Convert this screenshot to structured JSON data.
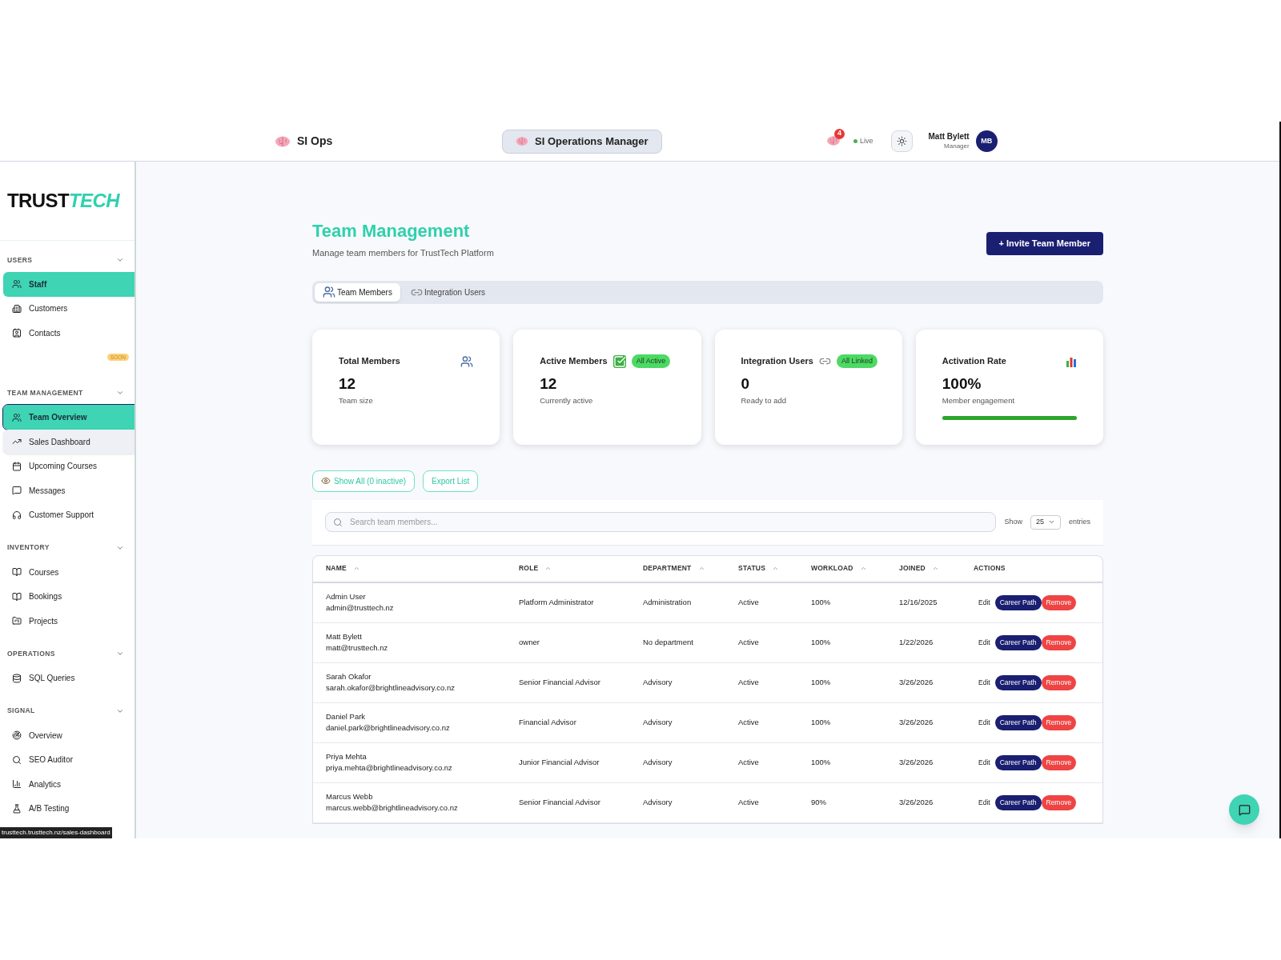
{
  "header": {
    "app_name": "SI Ops",
    "center_title": "SI Operations Manager",
    "notification_count": "4",
    "live_label": "Live",
    "user": {
      "name": "Matt Bylett",
      "role": "Manager",
      "initials": "MB"
    }
  },
  "sidebar": {
    "logo": {
      "first": "TRUST",
      "second": "TECH"
    },
    "sections": [
      {
        "title": "USERS",
        "expanded": true,
        "items": [
          {
            "label": "Staff",
            "selected": true,
            "hovered": false,
            "focused": false
          },
          {
            "label": "Customers",
            "selected": false,
            "hovered": false,
            "focused": false
          },
          {
            "label": "Contacts",
            "selected": false,
            "hovered": false,
            "focused": false
          }
        ],
        "badge": "SOON"
      },
      {
        "title": "TEAM MANAGEMENT",
        "expanded": true,
        "items": [
          {
            "label": "Team Overview",
            "selected": true,
            "hovered": false,
            "focused": true
          },
          {
            "label": "Sales Dashboard",
            "selected": false,
            "hovered": true,
            "focused": false
          },
          {
            "label": "Upcoming Courses",
            "selected": false,
            "hovered": false,
            "focused": false
          },
          {
            "label": "Messages",
            "selected": false,
            "hovered": false,
            "focused": false
          },
          {
            "label": "Customer Support",
            "selected": false,
            "hovered": false,
            "focused": false
          }
        ]
      },
      {
        "title": "INVENTORY",
        "expanded": true,
        "items": [
          {
            "label": "Courses",
            "selected": false,
            "hovered": false,
            "focused": false
          },
          {
            "label": "Bookings",
            "selected": false,
            "hovered": false,
            "focused": false
          },
          {
            "label": "Projects",
            "selected": false,
            "hovered": false,
            "focused": false
          }
        ]
      },
      {
        "title": "OPERATIONS",
        "expanded": true,
        "items": [
          {
            "label": "SQL Queries",
            "selected": false,
            "hovered": false,
            "focused": false
          }
        ]
      },
      {
        "title": "SIGNAL",
        "expanded": true,
        "items": [
          {
            "label": "Overview",
            "selected": false,
            "hovered": false,
            "focused": false
          },
          {
            "label": "SEO Auditor",
            "selected": false,
            "hovered": false,
            "focused": false
          },
          {
            "label": "Analytics",
            "selected": false,
            "hovered": false,
            "focused": false
          },
          {
            "label": "A/B Testing",
            "selected": false,
            "hovered": false,
            "focused": false
          }
        ]
      }
    ]
  },
  "status_url": "trusttech.trusttech.nz/sales-dashboard",
  "page": {
    "title": "Team Management",
    "subtitle": "Manage team members for TrustTech Platform",
    "invite_button": "+ Invite Team Member",
    "tabs": [
      {
        "label": "Team Members",
        "selected": true
      },
      {
        "label": "Integration Users",
        "selected": false
      }
    ],
    "stats": [
      {
        "title": "Total Members",
        "value": "12",
        "caption": "Team size"
      },
      {
        "title": "Active Members",
        "badge": "All Active",
        "value": "12",
        "caption": "Currently active"
      },
      {
        "title": "Integration Users",
        "badge": "All Linked",
        "value": "0",
        "caption": "Ready to add"
      },
      {
        "title": "Activation Rate",
        "value": "100%",
        "caption": "Member engagement",
        "level": 1
      }
    ],
    "show_all_button": "Show All (0 inactive)",
    "export_button": "Export List",
    "search": {
      "placeholder": "Search team members..."
    },
    "show_label": "Show",
    "page_size": "25",
    "entries_label": "entries",
    "table": {
      "columns": [
        "NAME",
        "ROLE",
        "DEPARTMENT",
        "STATUS",
        "WORKLOAD",
        "JOINED",
        "ACTIONS"
      ],
      "rows": [
        {
          "name": "Admin User",
          "email": "admin@trusttech.nz",
          "role": "Platform Administrator",
          "department": "Administration",
          "status": "Active",
          "workload": "100%",
          "joined": "12/16/2025",
          "actions": [
            "Edit",
            "Career Path",
            "Remove"
          ]
        },
        {
          "name": "Matt Bylett",
          "email": "matt@trusttech.nz",
          "role": "owner",
          "department": "No department",
          "status": "Active",
          "workload": "100%",
          "joined": "1/22/2026",
          "actions": [
            "Edit",
            "Career Path",
            "Remove"
          ]
        },
        {
          "name": "Sarah Okafor",
          "email": "sarah.okafor@brightlineadvisory.co.nz",
          "role": "Senior Financial Advisor",
          "department": "Advisory",
          "status": "Active",
          "workload": "100%",
          "joined": "3/26/2026",
          "actions": [
            "Edit",
            "Career Path",
            "Remove"
          ]
        },
        {
          "name": "Daniel Park",
          "email": "daniel.park@brightlineadvisory.co.nz",
          "role": "Financial Advisor",
          "department": "Advisory",
          "status": "Active",
          "workload": "100%",
          "joined": "3/26/2026",
          "actions": [
            "Edit",
            "Career Path",
            "Remove"
          ]
        },
        {
          "name": "Priya Mehta",
          "email": "priya.mehta@brightlineadvisory.co.nz",
          "role": "Junior Financial Advisor",
          "department": "Advisory",
          "status": "Active",
          "workload": "100%",
          "joined": "3/26/2026",
          "actions": [
            "Edit",
            "Career Path",
            "Remove"
          ]
        },
        {
          "name": "Marcus Webb",
          "email": "marcus.webb@brightlineadvisory.co.nz",
          "role": "Senior Financial Advisor",
          "department": "Advisory",
          "status": "Active",
          "workload": "90%",
          "joined": "3/26/2026",
          "actions": [
            "Edit",
            "Career Path",
            "Remove"
          ]
        }
      ]
    }
  }
}
